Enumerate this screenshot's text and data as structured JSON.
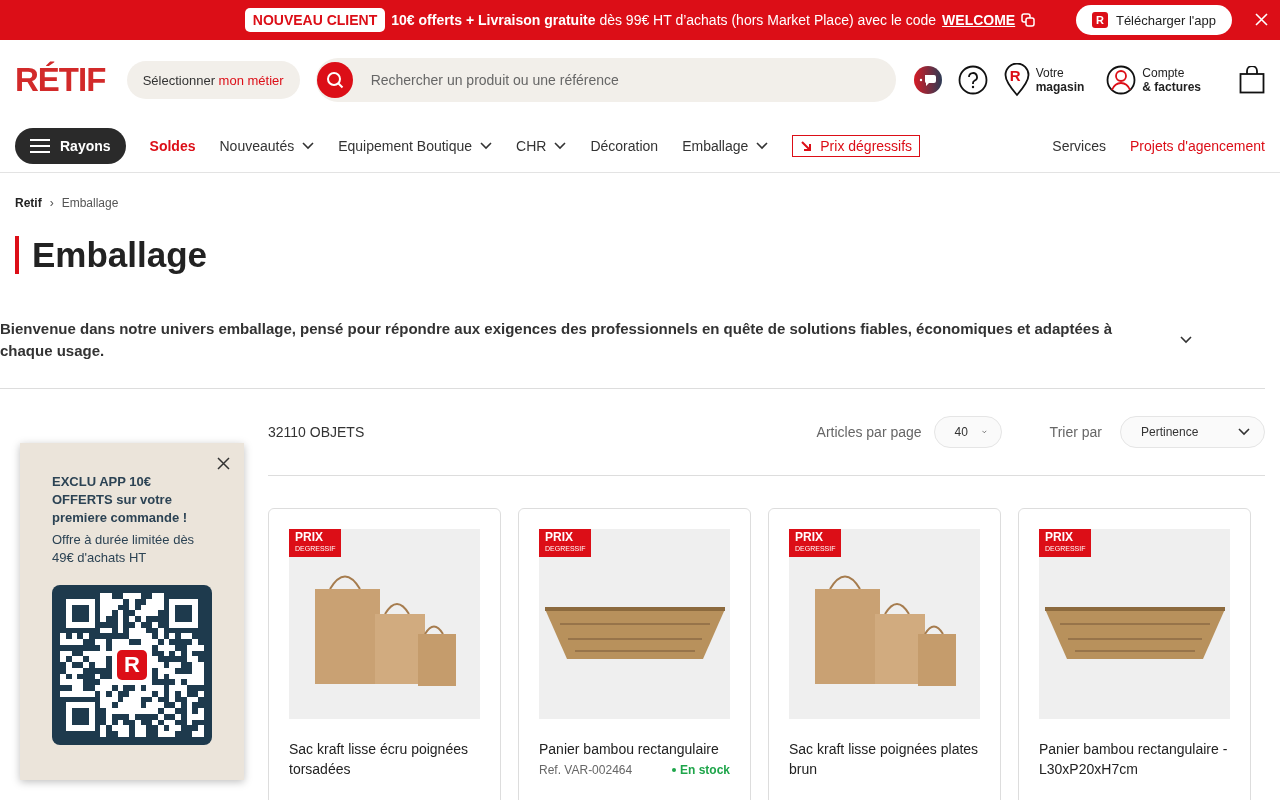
{
  "promo_bar": {
    "badge": "NOUVEAU CLIENT",
    "message": "**10€ offerts + Livraison gratuite** dès 99€ HT d’achats (hors Market Place) avec le code",
    "code": "WELCOME",
    "app_button": {
      "logo": "R",
      "label": "Télécharger l'app"
    }
  },
  "header": {
    "logo": "RÉTIF",
    "job_selector": {
      "label": "Sélectionner",
      "highlight": "mon métier"
    },
    "search": {
      "placeholder": "Rechercher un produit ou une référence"
    },
    "store": {
      "logo": "R",
      "line1": "Votre",
      "line2": "magasin"
    },
    "account": {
      "line1": "Compte",
      "line2": "& factures"
    }
  },
  "nav": {
    "menu_button": "Rayons",
    "items": [
      {
        "label": "Soldes",
        "kind": "sale"
      },
      {
        "label": "Nouveautés",
        "kind": "dropdown"
      },
      {
        "label": "Equipement Boutique",
        "kind": "dropdown"
      },
      {
        "label": "CHR",
        "kind": "dropdown"
      },
      {
        "label": "Décoration",
        "kind": "link"
      },
      {
        "label": "Emballage",
        "kind": "dropdown"
      },
      {
        "label": "Prix dégressifs",
        "kind": "boxed"
      }
    ],
    "right_links": [
      {
        "label": "Services",
        "kind": "link"
      },
      {
        "label": "Projets d'agencement",
        "kind": "highlight"
      }
    ]
  },
  "breadcrumb": {
    "items": [
      "Retif",
      "Emballage"
    ],
    "separator": "›"
  },
  "page_title": "Emballage",
  "description": "Bienvenue dans notre univers emballage, pensé pour répondre aux exigences des professionnels en quête de solutions fiables, économiques et adaptées à chaque usage.",
  "listing": {
    "count": "32110 OBJETS",
    "per_page": {
      "label": "Articles par page",
      "value": "40"
    },
    "sort": {
      "label": "Trier par",
      "value": "Pertinence"
    }
  },
  "products": [
    {
      "name": "Sac kraft lisse écru poignées torsadées",
      "badge": [
        "PRIX",
        "DEGRESSIF"
      ],
      "kind": "bags"
    },
    {
      "name": "Panier bambou rectangulaire",
      "badge": [
        "PRIX",
        "DEGRESSIF"
      ],
      "kind": "basket",
      "ref": "Ref. VAR-002464",
      "stock": "En stock"
    },
    {
      "name": "Sac kraft lisse poignées plates brun",
      "badge": [
        "PRIX",
        "DEGRESSIF"
      ],
      "kind": "bags"
    },
    {
      "name": "Panier bambou rectangulaire - L30xP20xH7cm",
      "badge": [
        "PRIX",
        "DEGRESSIF"
      ],
      "kind": "basket"
    }
  ],
  "app_popup": {
    "title": "EXCLU APP 10€ OFFERTS sur votre premiere commande !",
    "text": "Offre à durée limitée dès 49€ d'achats HT",
    "logo": "R"
  }
}
